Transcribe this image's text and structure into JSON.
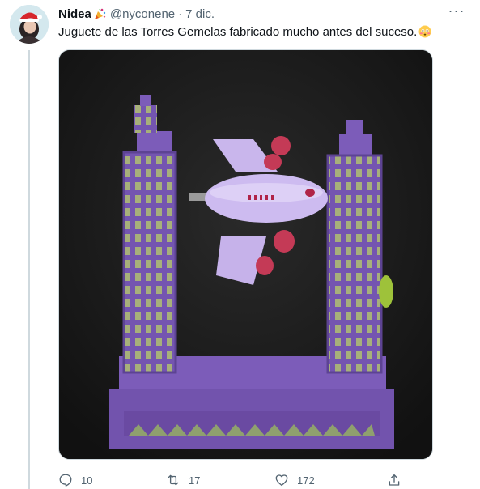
{
  "tweet": {
    "author_name": "Nidea",
    "handle": "@nyconene",
    "separator": "·",
    "date": "7 dic.",
    "more_label": "···",
    "text": "Juguete de las Torres Gemelas fabricado mucho antes del suceso.",
    "emoji_name_icon": "party-popper-icon",
    "emoji_text_icon": "flushed-face-icon"
  },
  "actions": {
    "reply_count": "10",
    "retweet_count": "17",
    "like_count": "172"
  },
  "colors": {
    "secondary_text": "#536471",
    "border": "#cfd9de",
    "toy_purple": "#7a5ab8",
    "plane_lavender": "#c9b6ec"
  }
}
